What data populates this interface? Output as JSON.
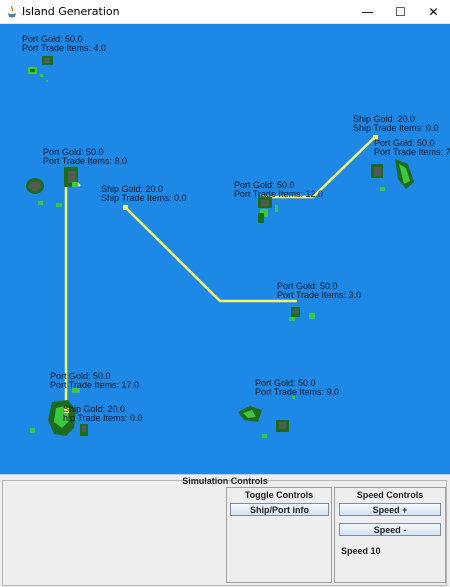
{
  "window": {
    "title": "Island Generation",
    "minimize_glyph": "—",
    "maximize_glyph": "☐",
    "close_glyph": "✕"
  },
  "map": {
    "ports": [
      {
        "gold": "Port Gold: 50.0",
        "trade": "Port Trade Items: 4.0"
      },
      {
        "gold": "Port Gold: 50.0",
        "trade": "Port Trade Items: 8.0"
      },
      {
        "gold": "Port Gold: 50.0",
        "trade": "Port Trade Items: 7"
      },
      {
        "gold": "Port Gold: 50.0",
        "trade": "Port Trade Items: 12.0"
      },
      {
        "gold": "Port Gold: 50.0",
        "trade": "Port Trade Items: 3.0"
      },
      {
        "gold": "Port Gold: 50.0",
        "trade": "Port Trade Items: 17.0"
      },
      {
        "gold": "Port Gold: 50.0",
        "trade": "Port Trade Items: 9.0"
      }
    ],
    "ships": [
      {
        "gold": "Ship Gold: 20.0",
        "trade": "Ship Trade Items: 0.0"
      },
      {
        "gold": "Ship Gold: 20.0",
        "trade": "Ship Trade Items: 0.0"
      },
      {
        "gold": "Ship Gold: 20.0",
        "trade": "hip Trade Items: 0.0"
      }
    ],
    "colors": {
      "ocean": "#1e88e6",
      "route": "#f5f56a",
      "land_dark": "#1d6b1d",
      "land_light": "#3cc83c",
      "rock": "#555a55"
    }
  },
  "controls": {
    "title": "Simulation Controls",
    "toggle": {
      "title": "Toggle Controls",
      "ship_port_info_label": "Ship/Port info"
    },
    "speed": {
      "title": "Speed Controls",
      "speed_up_label": "Speed +",
      "speed_down_label": "Speed -",
      "speed_text": "Speed 10"
    }
  }
}
